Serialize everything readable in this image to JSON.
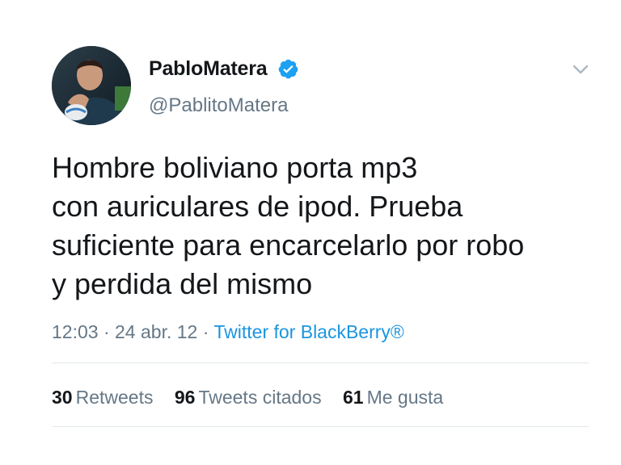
{
  "author": {
    "display_name": "PabloMatera",
    "handle": "@PablitoMatera",
    "verified": true
  },
  "icons": {
    "verified": "verified-badge-icon",
    "menu": "chevron-down-icon",
    "avatar": "profile-photo"
  },
  "tweet": {
    "lines": [
      "Hombre boliviano porta mp3",
      "con auriculares de ipod. Prueba",
      "suficiente para encarcelarlo por robo",
      "y perdida del mismo"
    ]
  },
  "meta": {
    "time": "12:03",
    "separator": "·",
    "date": "24 abr. 12",
    "source": "Twitter for BlackBerry®"
  },
  "stats": {
    "retweets_count": "30",
    "retweets_label": "Retweets",
    "quotes_count": "96",
    "quotes_label": "Tweets citados",
    "likes_count": "61",
    "likes_label": "Me gusta"
  },
  "colors": {
    "accent": "#1b95e0",
    "secondary_text": "#657786",
    "divider": "#e1e8ed",
    "verified": "#1da1f2"
  }
}
